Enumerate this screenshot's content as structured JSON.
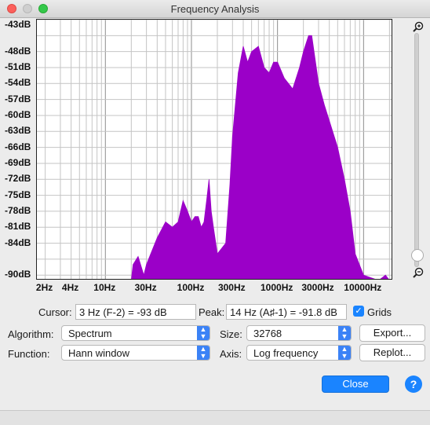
{
  "window": {
    "title": "Frequency Analysis"
  },
  "axes": {
    "y_ticks": [
      "-43dB",
      "-48dB",
      "-51dB",
      "-54dB",
      "-57dB",
      "-60dB",
      "-63dB",
      "-66dB",
      "-69dB",
      "-72dB",
      "-75dB",
      "-78dB",
      "-81dB",
      "-84dB",
      "-90dB"
    ],
    "x_ticks": [
      "2Hz",
      "4Hz",
      "10Hz",
      "30Hz",
      "100Hz",
      "300Hz",
      "1000Hz",
      "3000Hz",
      "10000Hz"
    ]
  },
  "cursor": {
    "label": "Cursor:",
    "value": "3 Hz (F-2) = -93 dB"
  },
  "peak": {
    "label": "Peak:",
    "value": "14 Hz (A♯-1) = -91.8 dB"
  },
  "grids": {
    "label": "Grids",
    "checked": true
  },
  "algorithm": {
    "label": "Algorithm:",
    "value": "Spectrum"
  },
  "size": {
    "label": "Size:",
    "value": "32768"
  },
  "function": {
    "label": "Function:",
    "value": "Hann window"
  },
  "axis": {
    "label": "Axis:",
    "value": "Log frequency"
  },
  "buttons": {
    "export": "Export...",
    "replot": "Replot...",
    "close": "Close",
    "help": "?"
  },
  "colors": {
    "spectrum": "#9b00c8",
    "grid": "#b8b8b8",
    "accent": "#1a84ff"
  },
  "chart_data": {
    "type": "area",
    "x_scale": "log",
    "xlim": [
      1.6,
      22050
    ],
    "ylim": [
      -91,
      -42
    ],
    "x": [
      1.6,
      2,
      4,
      10,
      20,
      21,
      24,
      28,
      30,
      40,
      50,
      60,
      70,
      80,
      90,
      100,
      110,
      120,
      130,
      140,
      150,
      160,
      170,
      180,
      200,
      250,
      280,
      300,
      350,
      400,
      450,
      500,
      600,
      700,
      800,
      900,
      1000,
      1200,
      1500,
      1800,
      2000,
      2300,
      2500,
      3000,
      3500,
      4000,
      5000,
      6000,
      7000,
      8000,
      10000,
      15000,
      18000,
      20000
    ],
    "y": [
      -93,
      -93,
      -93,
      -93,
      -93,
      -88,
      -86.5,
      -90,
      -88,
      -83,
      -80,
      -81,
      -80,
      -76,
      -78,
      -80,
      -79,
      -79,
      -81,
      -80,
      -76,
      -72,
      -78,
      -81,
      -86,
      -84,
      -73,
      -64,
      -52,
      -47,
      -50,
      -48,
      -47,
      -51,
      -52,
      -50,
      -50,
      -53,
      -55,
      -51,
      -48,
      -45,
      -45,
      -54,
      -58,
      -61,
      -66,
      -72,
      -78,
      -86,
      -90,
      -93,
      -90,
      -93
    ]
  }
}
